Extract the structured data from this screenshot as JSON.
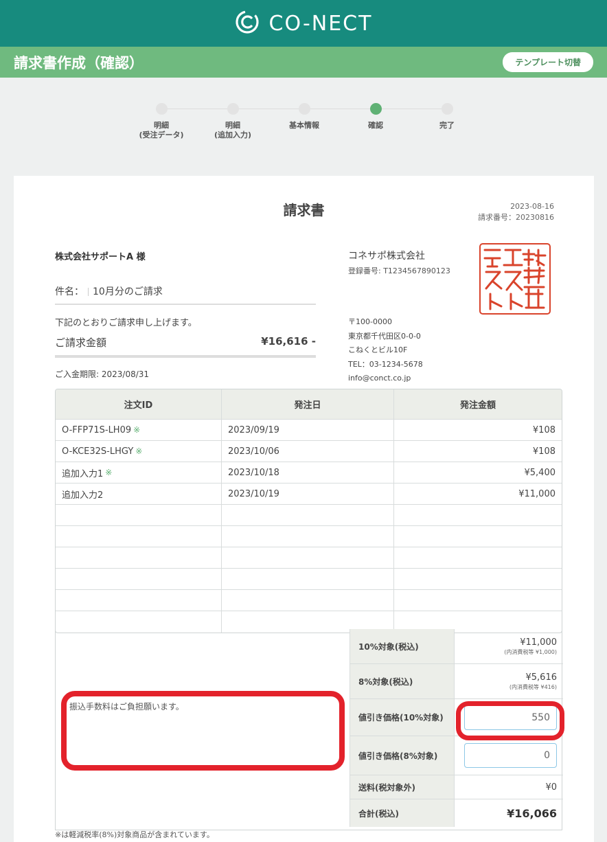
{
  "app": {
    "logo_text": "CO-NECT",
    "logo_icon": "conect-logo-icon"
  },
  "header": {
    "title": "請求書作成（確認）",
    "template_button": "テンプレート切替"
  },
  "steps": [
    {
      "line1": "明細",
      "line2": "(受注データ)",
      "active": false
    },
    {
      "line1": "明細",
      "line2": "(追加入力)",
      "active": false
    },
    {
      "line1": "基本情報",
      "line2": "",
      "active": false
    },
    {
      "line1": "確認",
      "line2": "",
      "active": true
    },
    {
      "line1": "完了",
      "line2": "",
      "active": false
    }
  ],
  "invoice": {
    "title": "請求書",
    "date": "2023-08-16",
    "number": "請求番号：20230816",
    "customer": "株式会社サポートA 様",
    "subject_label": "件名：",
    "subject_value": "10月分のご請求",
    "intro": "下記のとおりご請求申し上げます。",
    "amount_label": "ご請求金額",
    "amount_value": "¥16,616 -",
    "deadline": "ご入金期限: 2023/08/31"
  },
  "issuer": {
    "name": "コネサポ株式会社",
    "reg_no": "登録番号: T1234567890123",
    "postal": "〒100-0000",
    "address1": "東京都千代田区0-0-0",
    "address2": "こねくとビル10F",
    "tel": "TEL：03-1234-5678",
    "email": "info@conct.co.jp",
    "seal_text": "株式会社テストテスト"
  },
  "table": {
    "headers": [
      "注文ID",
      "発注日",
      "発注金額"
    ],
    "rows": [
      {
        "id": "O-FFP71S-LH09",
        "mark": "※",
        "date": "2023/09/19",
        "amount": "¥108"
      },
      {
        "id": "O-KCE32S-LHGY",
        "mark": "※",
        "date": "2023/10/06",
        "amount": "¥108"
      },
      {
        "id": "追加入力1",
        "mark": "※",
        "date": "2023/10/18",
        "amount": "¥5,400"
      },
      {
        "id": "追加入力2",
        "mark": "",
        "date": "2023/10/19",
        "amount": "¥11,000"
      }
    ]
  },
  "memo": "振込手数料はご負担願います。",
  "summary": {
    "tax10_label": "10%対象(税込)",
    "tax10_value": "¥11,000",
    "tax10_note": "(内消費税等 ¥1,000)",
    "tax8_label": "8%対象(税込)",
    "tax8_value": "¥5,616",
    "tax8_note": "(内消費税等 ¥416)",
    "disc10_label": "値引き価格(10%対象)",
    "disc10_value": "550",
    "disc8_label": "値引き価格(8%対象)",
    "disc8_value": "0",
    "shipping_label": "送料(税対象外)",
    "shipping_value": "¥0",
    "total_label": "合計(税込)",
    "total_value": "¥16,066"
  },
  "footnote": "※は軽減税率(8%)対象商品が含まれています。",
  "colors": {
    "brand": "#178b7e",
    "title_bar": "#6fba7f",
    "active_step": "#5fb174",
    "highlight": "#e3222b",
    "seal": "#d9432b"
  }
}
